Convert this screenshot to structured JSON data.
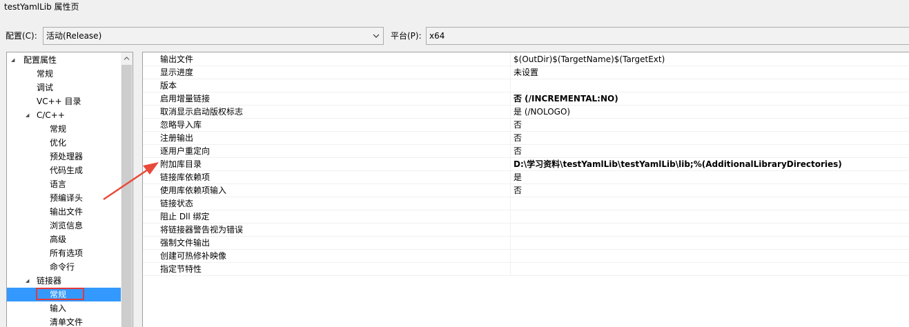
{
  "window": {
    "title": "testYamlLib 属性页"
  },
  "config_bar": {
    "config_label": "配置(C):",
    "config_value": "活动(Release)",
    "platform_label": "平台(P):",
    "platform_value": "x64"
  },
  "tree": {
    "items": [
      {
        "label": "配置属性",
        "expanded": true
      },
      {
        "label": "常规"
      },
      {
        "label": "调试"
      },
      {
        "label": "VC++ 目录"
      },
      {
        "label": "C/C++",
        "expanded": true
      },
      {
        "label": "常规"
      },
      {
        "label": "优化"
      },
      {
        "label": "预处理器"
      },
      {
        "label": "代码生成"
      },
      {
        "label": "语言"
      },
      {
        "label": "预编译头"
      },
      {
        "label": "输出文件"
      },
      {
        "label": "浏览信息"
      },
      {
        "label": "高级"
      },
      {
        "label": "所有选项"
      },
      {
        "label": "命令行"
      },
      {
        "label": "链接器",
        "expanded": true
      },
      {
        "label": "常规",
        "selected": true
      },
      {
        "label": "输入"
      },
      {
        "label": "清单文件"
      }
    ]
  },
  "grid": {
    "rows": [
      {
        "name": "输出文件",
        "value": "$(OutDir)$(TargetName)$(TargetExt)",
        "bold": false
      },
      {
        "name": "显示进度",
        "value": "未设置",
        "bold": false
      },
      {
        "name": "版本",
        "value": "",
        "bold": false
      },
      {
        "name": "启用增量链接",
        "value": "否 (/INCREMENTAL:NO)",
        "bold": true
      },
      {
        "name": "取消显示启动版权标志",
        "value": "是 (/NOLOGO)",
        "bold": false
      },
      {
        "name": "忽略导入库",
        "value": "否",
        "bold": false
      },
      {
        "name": "注册输出",
        "value": "否",
        "bold": false
      },
      {
        "name": "逐用户重定向",
        "value": "否",
        "bold": false
      },
      {
        "name": "附加库目录",
        "value": "D:\\学习资料\\testYamlLib\\testYamlLib\\lib;%(AdditionalLibraryDirectories)",
        "bold": true
      },
      {
        "name": "链接库依赖项",
        "value": "是",
        "bold": false
      },
      {
        "name": "使用库依赖项输入",
        "value": "否",
        "bold": false
      },
      {
        "name": "链接状态",
        "value": "",
        "bold": false
      },
      {
        "name": "阻止 Dll 绑定",
        "value": "",
        "bold": false
      },
      {
        "name": "将链接器警告视为错误",
        "value": "",
        "bold": false
      },
      {
        "name": "强制文件输出",
        "value": "",
        "bold": false
      },
      {
        "name": "创建可热修补映像",
        "value": "",
        "bold": false
      },
      {
        "name": "指定节特性",
        "value": "",
        "bold": false
      }
    ]
  },
  "colors": {
    "selection": "#3399ff",
    "annotation": "#e03a3a"
  }
}
